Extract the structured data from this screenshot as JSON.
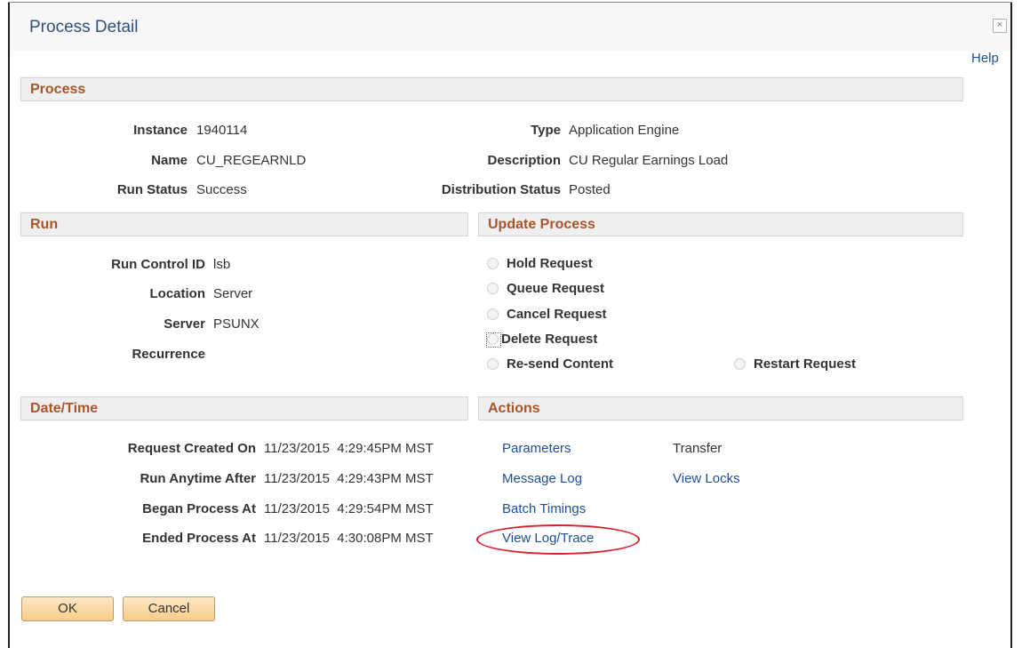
{
  "window": {
    "title": "Process Detail",
    "close_glyph": "×",
    "help": "Help"
  },
  "process": {
    "header": "Process",
    "instance_label": "Instance",
    "instance_value": "1940114",
    "name_label": "Name",
    "name_value": "CU_REGEARNLD",
    "run_status_label": "Run Status",
    "run_status_value": "Success",
    "type_label": "Type",
    "type_value": "Application Engine",
    "description_label": "Description",
    "description_value": "CU Regular Earnings Load",
    "distribution_label": "Distribution Status",
    "distribution_value": "Posted"
  },
  "run": {
    "header": "Run",
    "run_control_label": "Run Control ID",
    "run_control_value": "lsb",
    "location_label": "Location",
    "location_value": "Server",
    "server_label": "Server",
    "server_value": "PSUNX",
    "recurrence_label": "Recurrence"
  },
  "update_process": {
    "header": "Update Process",
    "options": [
      "Hold Request",
      "Queue Request",
      "Cancel Request",
      "Delete Request",
      "Re-send Content",
      "Restart Request"
    ]
  },
  "datetime": {
    "header": "Date/Time",
    "rows": [
      {
        "label": "Request Created On",
        "value": "11/23/2015  4:29:45PM MST"
      },
      {
        "label": "Run Anytime After",
        "value": "11/23/2015  4:29:43PM MST"
      },
      {
        "label": "Began Process At",
        "value": "11/23/2015  4:29:54PM MST"
      },
      {
        "label": "Ended Process At",
        "value": "11/23/2015  4:30:08PM MST"
      }
    ]
  },
  "actions": {
    "header": "Actions",
    "parameters": "Parameters",
    "transfer": "Transfer",
    "message_log": "Message Log",
    "view_locks": "View Locks",
    "batch_timings": "Batch Timings",
    "view_log_trace": "View Log/Trace"
  },
  "buttons": {
    "ok": "OK",
    "cancel": "Cancel"
  },
  "colors": {
    "section_title": "#a8552a",
    "link": "#1f4e92",
    "highlight_ellipse": "#d9202a"
  }
}
